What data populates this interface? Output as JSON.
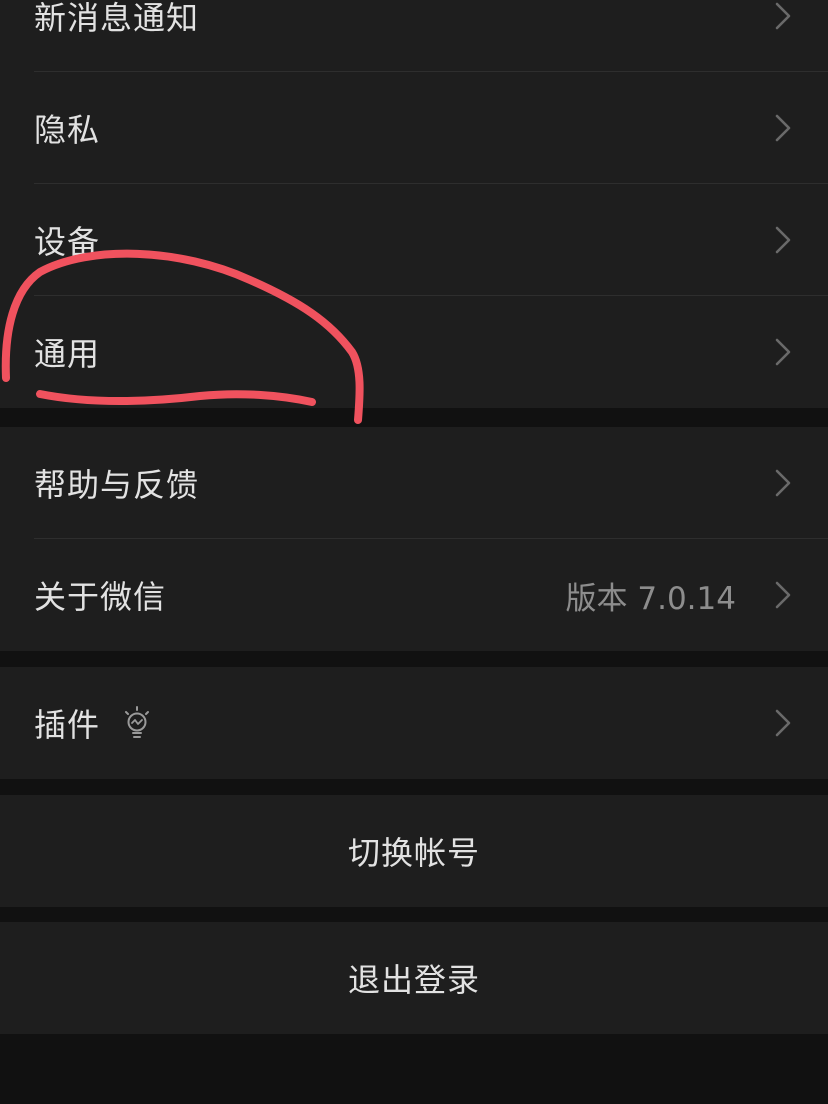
{
  "groups": {
    "settings_top": {
      "items": [
        {
          "label": "新消息通知"
        },
        {
          "label": "隐私"
        },
        {
          "label": "设备"
        },
        {
          "label": "通用"
        }
      ]
    },
    "settings_help": {
      "items": [
        {
          "label": "帮助与反馈"
        },
        {
          "label": "关于微信",
          "value": "版本 7.0.14"
        }
      ]
    },
    "settings_plugins": {
      "items": [
        {
          "label": "插件",
          "icon": "lightbulb-icon"
        }
      ]
    },
    "account": {
      "switch_label": "切换帐号",
      "logout_label": "退出登录"
    }
  },
  "colors": {
    "background": "#111111",
    "cell": "#1e1e1e",
    "text": "#e2e2e2",
    "secondary_text": "#8d8d8d",
    "annotation": "#f0525e"
  }
}
